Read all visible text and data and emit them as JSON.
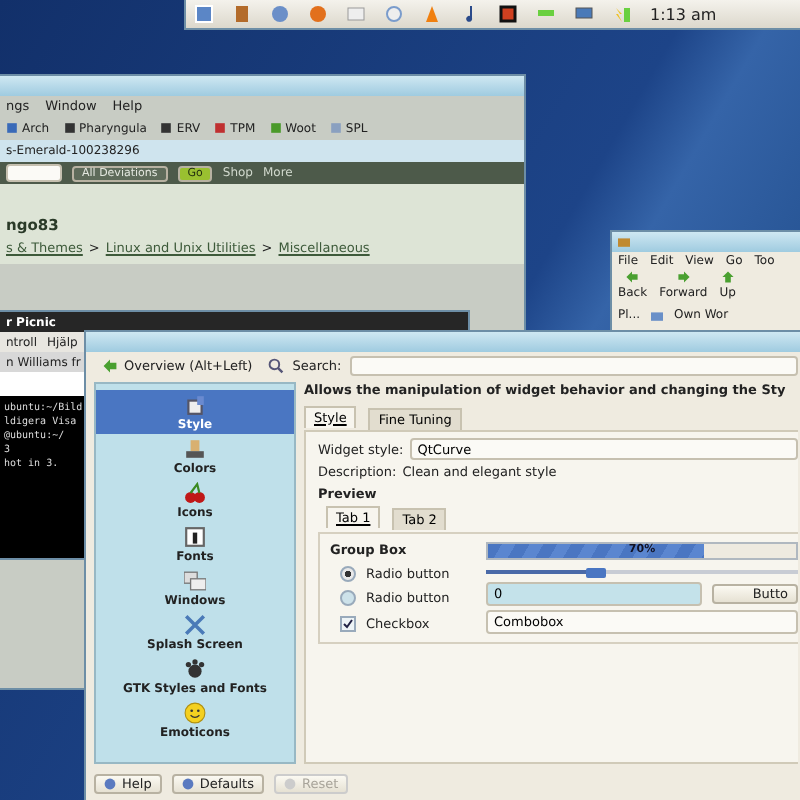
{
  "panel": {
    "clock": "1:13 am"
  },
  "browser": {
    "menu": [
      "ngs",
      "Window",
      "Help"
    ],
    "bookmarks": [
      "Arch",
      "Pharyngula",
      "ERV",
      "TPM",
      "Woot",
      "SPL"
    ],
    "address": "s-Emerald-100238296",
    "nav": {
      "scope": "All Deviations",
      "go": "Go",
      "links": [
        "Shop",
        "More"
      ]
    },
    "author": "ngo83",
    "breadcrumb": {
      "separator": ">",
      "items": [
        "s & Themes",
        "Linux and Unix Utilities",
        "Miscellaneous"
      ]
    }
  },
  "terminal": {
    "title": "r Picnic",
    "menu": [
      "ntroll",
      "Hjälp"
    ],
    "tab": "n Williams fr",
    "lines": [
      "ubuntu:~/Bild",
      "ldigera Visa",
      "@ubuntu:~/",
      "3",
      "hot in 3."
    ]
  },
  "file_manager": {
    "menu": [
      "File",
      "Edit",
      "View",
      "Go",
      "Too"
    ],
    "toolbar": [
      "Back",
      "Forward",
      "Up"
    ],
    "panel_label": "Pl...",
    "location": "Own Wor"
  },
  "settings": {
    "toolbar": {
      "back": "Overview (Alt+Left)",
      "search_label": "Search:"
    },
    "categories": [
      {
        "label": "Style",
        "selected": true
      },
      {
        "label": "Colors",
        "selected": false
      },
      {
        "label": "Icons",
        "selected": false
      },
      {
        "label": "Fonts",
        "selected": false
      },
      {
        "label": "Windows",
        "selected": false
      },
      {
        "label": "Splash Screen",
        "selected": false
      },
      {
        "label": "GTK Styles and Fonts",
        "selected": false
      },
      {
        "label": "Emoticons",
        "selected": false
      }
    ],
    "heading": "Allows the manipulation of widget behavior and changing the Sty",
    "tabs": [
      {
        "label": "Style",
        "selected": true
      },
      {
        "label": "Fine Tuning",
        "selected": false
      }
    ],
    "widget_style": {
      "label": "Widget style:",
      "value": "QtCurve"
    },
    "description": {
      "label": "Description:",
      "value": "Clean and elegant style"
    },
    "preview": {
      "title": "Preview",
      "tabs": [
        {
          "label": "Tab 1",
          "selected": true
        },
        {
          "label": "Tab 2",
          "selected": false
        }
      ],
      "group_title": "Group Box",
      "radios": [
        {
          "label": "Radio button",
          "selected": true
        },
        {
          "label": "Radio button",
          "selected": false
        }
      ],
      "checkbox": {
        "label": "Checkbox",
        "checked": true
      },
      "progress": {
        "level": 0.7,
        "reading": "70%"
      },
      "slider": {
        "level": 0.35
      },
      "spin": "0",
      "button": "Butto",
      "combo": "Combobox"
    },
    "buttons": [
      {
        "label": "Help",
        "disabled": false
      },
      {
        "label": "Defaults",
        "disabled": false
      },
      {
        "label": "Reset",
        "disabled": true
      }
    ]
  }
}
